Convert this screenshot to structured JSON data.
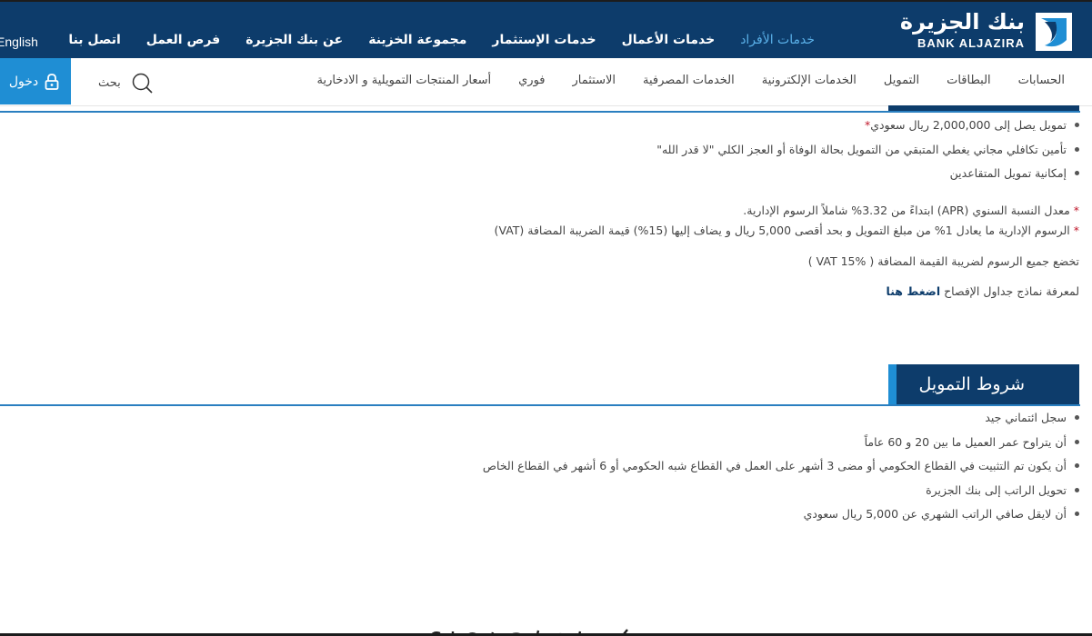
{
  "brand": {
    "logo_ar": "بنك الجزيرة",
    "logo_en": "BANK ALJAZIRA",
    "primary_color": "#0d3c6b",
    "accent_color": "#1f8ed4"
  },
  "top_nav": {
    "items": [
      {
        "label": "خدمات الأفراد",
        "active": true
      },
      {
        "label": "خدمات الأعمال"
      },
      {
        "label": "خدمات الإستثمار"
      },
      {
        "label": "مجموعة الخزينة"
      },
      {
        "label": "عن بنك الجزيرة"
      },
      {
        "label": "فرص العمل"
      },
      {
        "label": "اتصل بنا"
      }
    ],
    "language": "English"
  },
  "sub_nav": {
    "items": [
      "الحسابات",
      "البطاقات",
      "التمويل",
      "الخدمات الإلكترونية",
      "الخدمات المصرفية",
      "الاستثمار",
      "فوري",
      "أسعار المنتجات التمويلية و الادخارية"
    ],
    "search_label": "بحث",
    "login_label": "دخول"
  },
  "features": {
    "bullets": [
      {
        "text": "تمويل يصل إلى 2,000,000 ريال سعودي",
        "star": "*"
      },
      {
        "text": "تأمين تكافلي مجاني يغطي المتبقي من التمويل بحالة الوفاة أو العجز الكلي \"لا قدر الله\""
      },
      {
        "text": "إمكانية تمويل المتقاعدين"
      }
    ],
    "notes": [
      {
        "star": "*",
        "text": "معدل النسبة السنوي (APR) ابتداءً من 3.32% شاملاً الرسوم الإدارية."
      },
      {
        "star": "*",
        "text": "الرسوم الإدارية ما يعادل 1% من مبلغ التمويل و بحد أقصى 5,000 ريال و يضاف إليها (15%) قيمة الضريبة المضافة (VAT)"
      }
    ],
    "vat_note": "تخضع جميع الرسوم لضريبة القيمة المضافة ( VAT 15% )",
    "disclosure_text": "لمعرفة نماذج جداول الإفصاح ",
    "click_here": "اضغط هنا"
  },
  "terms": {
    "heading": "شروط التمويل",
    "items": [
      "سجل ائتماني جيد",
      "أن يتراوح عمر العميل ما بين 20 و 60 عاماً",
      "أن يكون تم التثبيت في القطاع الحكومي أو مضى 3 أشهر على العمل في القطاع شبه الحكومي أو 6 أشهر في القطاع الخاص",
      "تحويل الراتب إلى بنك الجزيرة",
      "أن لايقل صافي الراتب الشهري عن 5,000 ريال سعودي"
    ]
  },
  "icons": {
    "logo": "bank-aljazira-logo-mark",
    "search": "search-icon",
    "login": "lock-icon"
  }
}
